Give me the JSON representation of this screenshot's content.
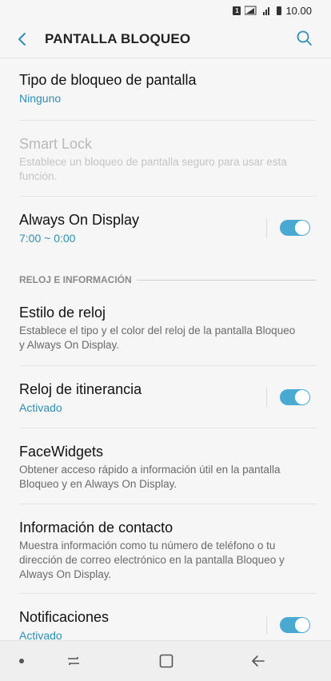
{
  "status_bar": {
    "sim": "1",
    "time": "10.00"
  },
  "app_bar": {
    "title": "PANTALLA BLOQUEO"
  },
  "items": {
    "lock_type": {
      "title": "Tipo de bloqueo de pantalla",
      "subtitle": "Ninguno"
    },
    "smart_lock": {
      "title": "Smart Lock",
      "subtitle": "Establece un bloqueo de pantalla seguro para usar esta función."
    },
    "always_on": {
      "title": "Always On Display",
      "subtitle": "7:00 ~ 0:00",
      "enabled": true
    },
    "section_clock": "RELOJ E INFORMACIÓN",
    "clock_style": {
      "title": "Estilo de reloj",
      "subtitle": "Establece el tipo y el color del reloj de la pantalla Bloqueo y Always On Display."
    },
    "roaming_clock": {
      "title": "Reloj de itinerancia",
      "subtitle": "Activado",
      "enabled": true
    },
    "face_widgets": {
      "title": "FaceWidgets",
      "subtitle": "Obtener acceso rápido a información útil en la pantalla Bloqueo y en Always On Display."
    },
    "contact_info": {
      "title": "Información de contacto",
      "subtitle": "Muestra información como tu número de teléfono o tu dirección de correo electrónico en la pantalla Bloqueo y Always On Display."
    },
    "notifications": {
      "title": "Notificaciones",
      "subtitle": "Activado",
      "enabled": true
    }
  },
  "colors": {
    "accent": "#2e8eb5",
    "toggle_on": "#4aa9d1"
  }
}
